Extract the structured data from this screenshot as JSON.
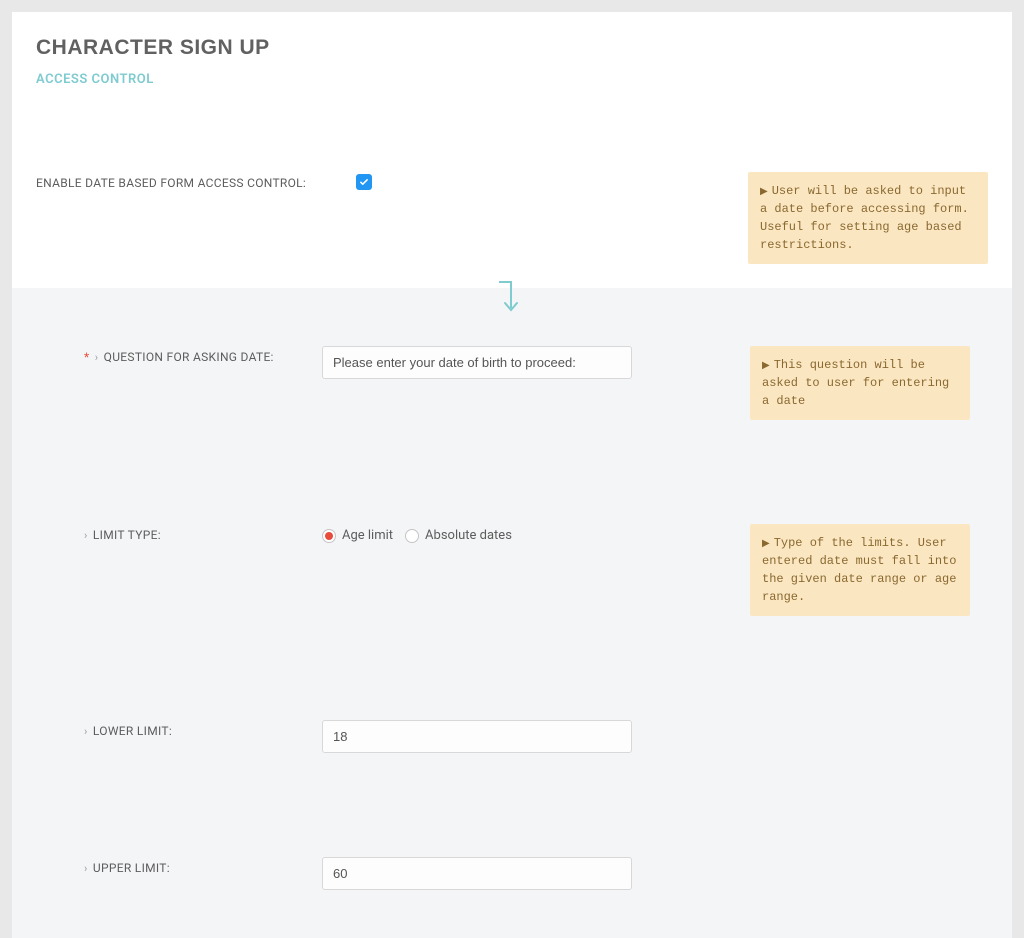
{
  "page": {
    "title": "CHARACTER SIGN UP",
    "subtitle": "ACCESS CONTROL"
  },
  "enable_row": {
    "label": "ENABLE DATE BASED FORM ACCESS CONTROL:",
    "checked": true,
    "help": "User will be asked to input a date before accessing form. Useful for setting age based restrictions."
  },
  "question_row": {
    "label": "QUESTION FOR ASKING DATE:",
    "value": "Please enter your date of birth to proceed:",
    "help": "This question will be asked to user for entering a date"
  },
  "limit_type_row": {
    "label": "LIMIT TYPE:",
    "options": {
      "age": "Age limit",
      "absolute": "Absolute dates"
    },
    "selected": "age",
    "help": "Type of the limits. User entered date must fall into the given date range or age range."
  },
  "lower_limit_row": {
    "label": "LOWER LIMIT:",
    "value": "18"
  },
  "upper_limit_row": {
    "label": "UPPER LIMIT:",
    "value": "60"
  }
}
